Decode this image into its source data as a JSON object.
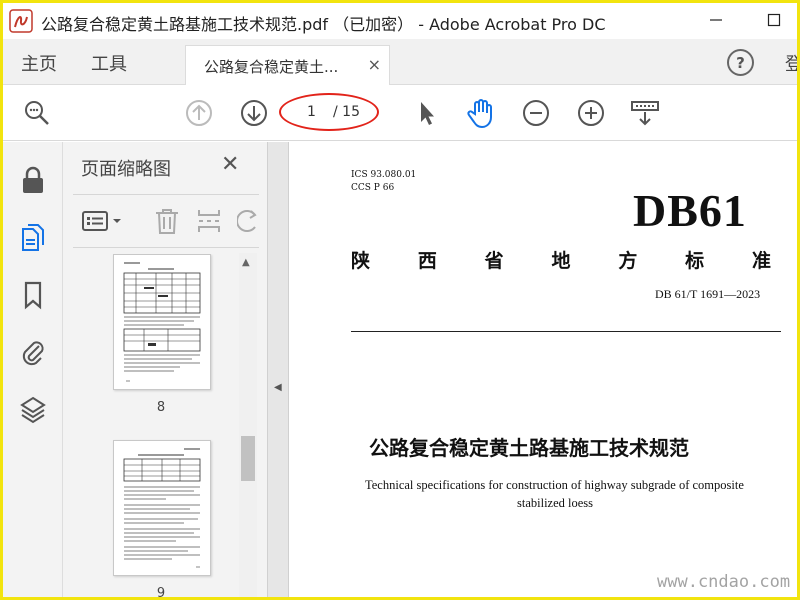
{
  "window": {
    "title": "公路复合稳定黄土路基施工技术规范.pdf （已加密） - Adobe Acrobat Pro DC",
    "minimize_icon": "minimize-icon",
    "maximize_icon": "maximize-icon"
  },
  "tabs": {
    "home": "主页",
    "tools": "工具",
    "doc_label": "公路复合稳定黄土...",
    "close_symbol": "×",
    "help_symbol": "?",
    "login_partial": "登"
  },
  "toolbar": {
    "page_current": "1",
    "page_total": "/ 15",
    "icons": [
      "zoom-search-icon",
      "prev-page-icon",
      "next-page-icon",
      "select-cursor-icon",
      "hand-tool-icon",
      "zoom-out-icon",
      "zoom-in-icon",
      "scroll-mode-icon"
    ]
  },
  "left_rail": {
    "icons": [
      "lock-icon",
      "page-thumbnails-icon",
      "bookmark-icon",
      "attachment-icon",
      "layers-icon"
    ]
  },
  "thumbnail_panel": {
    "title": "页面缩略图",
    "close_symbol": "✕",
    "thumbnails": [
      {
        "page_label": "8"
      },
      {
        "page_label": "9"
      }
    ]
  },
  "document": {
    "ics": "ICS  93.080.01",
    "ccs": "CCS P 66",
    "code": "DB61",
    "province_chars": [
      "陕",
      "西",
      "省",
      "地",
      "方",
      "标",
      "准"
    ],
    "standard_number": "DB 61/T 1691—2023",
    "title_cn": "公路复合稳定黄土路基施工技术规范",
    "title_en_line1": "Technical specifications for construction of highway subgrade of composite",
    "title_en_line2": "stabilized loess"
  },
  "watermark": "www.cndao.com",
  "colors": {
    "frame": "#f2e40e",
    "highlight_oval": "#e2231a",
    "active_blue": "#1473e6"
  }
}
